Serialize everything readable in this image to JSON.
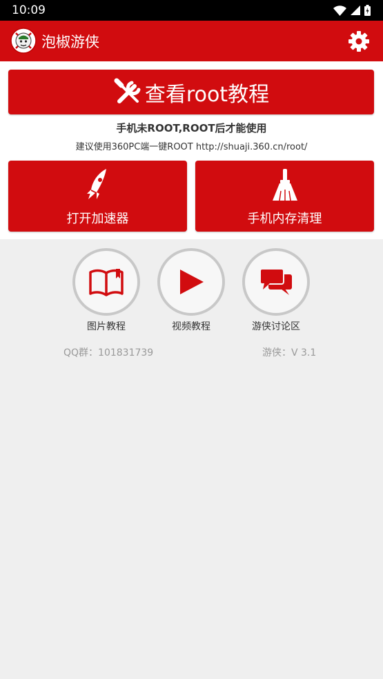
{
  "status_bar": {
    "time": "10:09",
    "icons": [
      "wifi-icon",
      "signal-icon",
      "battery-icon"
    ]
  },
  "app_bar": {
    "title": "泡椒游侠",
    "logo": "pepper-logo-icon",
    "settings_icon": "gear-icon"
  },
  "tutorial_button": {
    "label": "查看root教程",
    "icon": "tools-icon"
  },
  "root_notice": "手机未ROOT,ROOT后才能使用",
  "root_suggestion": "建议使用360PC端一键ROOT http://shuaji.360.cn/root/",
  "actions": [
    {
      "label": "打开加速器",
      "icon": "rocket-icon"
    },
    {
      "label": "手机内存清理",
      "icon": "broom-icon"
    }
  ],
  "shortcuts": [
    {
      "label": "图片教程",
      "icon": "book-icon"
    },
    {
      "label": "视频教程",
      "icon": "play-icon"
    },
    {
      "label": "游侠讨论区",
      "icon": "chat-bubbles-icon"
    }
  ],
  "footer": {
    "qq_group": "QQ群：101831739",
    "version": "游侠：V 3.1"
  },
  "colors": {
    "brand_red": "#d10c0f",
    "background": "#efefef",
    "circle_border": "#c8c8c8",
    "muted_text": "#999999"
  }
}
